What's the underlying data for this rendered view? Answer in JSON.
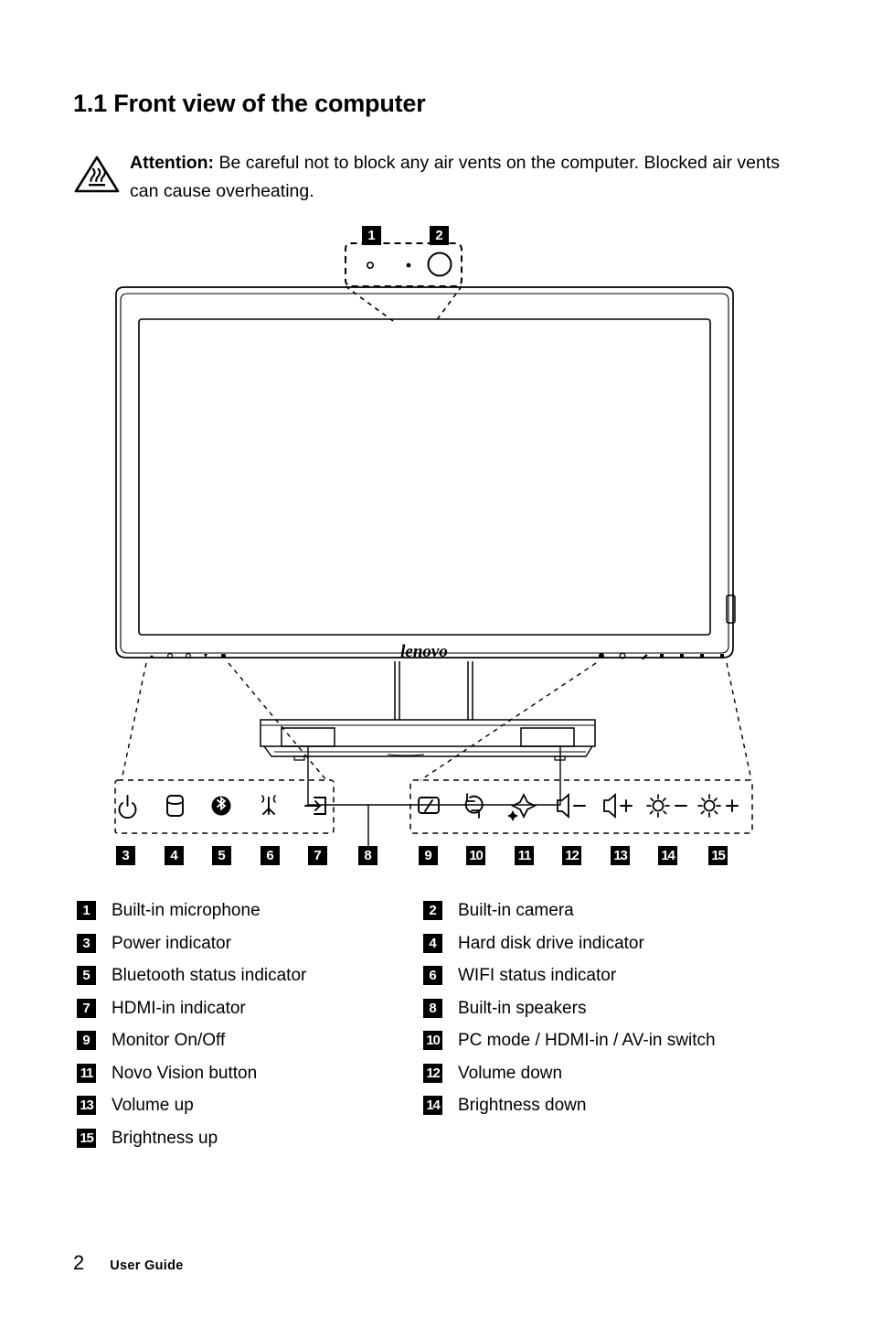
{
  "section": {
    "title": "1.1 Front view of the computer"
  },
  "attention": {
    "icon": "hot-surface-warning-icon",
    "label": "Attention:",
    "body": " Be careful not to block any air vents on the computer. Blocked air vents can cause overheating."
  },
  "illustration": {
    "brand_logo": "lenovo",
    "top_callouts": [
      {
        "number": "1",
        "target": "built-in-microphone"
      },
      {
        "number": "2",
        "target": "built-in-camera"
      }
    ],
    "left_indicator_group": {
      "callouts": [
        "3",
        "4",
        "5",
        "6",
        "7"
      ],
      "icons": [
        "power-icon",
        "hard-disk-icon",
        "bluetooth-icon",
        "wifi-icon",
        "hdmi-in-icon"
      ]
    },
    "speaker_callout": {
      "number": "8",
      "target": "built-in-speakers"
    },
    "right_control_group": {
      "callouts": [
        "9",
        "10",
        "11",
        "12",
        "13",
        "14",
        "15"
      ],
      "icons": [
        "monitor-onoff-icon",
        "mode-switch-icon",
        "novo-vision-icon",
        "volume-down-icon",
        "volume-up-icon",
        "brightness-down-icon",
        "brightness-up-icon"
      ]
    }
  },
  "legend": {
    "rows": [
      {
        "left": {
          "number": "1",
          "label": "Built-in microphone"
        },
        "right": {
          "number": "2",
          "label": "Built-in camera"
        }
      },
      {
        "left": {
          "number": "3",
          "label": "Power indicator"
        },
        "right": {
          "number": "4",
          "label": "Hard disk drive indicator"
        }
      },
      {
        "left": {
          "number": "5",
          "label": "Bluetooth status indicator"
        },
        "right": {
          "number": "6",
          "label": "WIFI status indicator"
        }
      },
      {
        "left": {
          "number": "7",
          "label": "HDMI-in indicator"
        },
        "right": {
          "number": "8",
          "label": "Built-in speakers"
        }
      },
      {
        "left": {
          "number": "9",
          "label": "Monitor On/Off"
        },
        "right": {
          "number": "10",
          "label": "PC mode / HDMI-in / AV-in switch"
        }
      },
      {
        "left": {
          "number": "11",
          "label": "Novo Vision button"
        },
        "right": {
          "number": "12",
          "label": "Volume down"
        }
      },
      {
        "left": {
          "number": "13",
          "label": "Volume up"
        },
        "right": {
          "number": "14",
          "label": "Brightness down"
        }
      },
      {
        "left": {
          "number": "15",
          "label": "Brightness up"
        },
        "right": null
      }
    ]
  },
  "footer": {
    "page_number": "2",
    "label": "User Guide"
  }
}
